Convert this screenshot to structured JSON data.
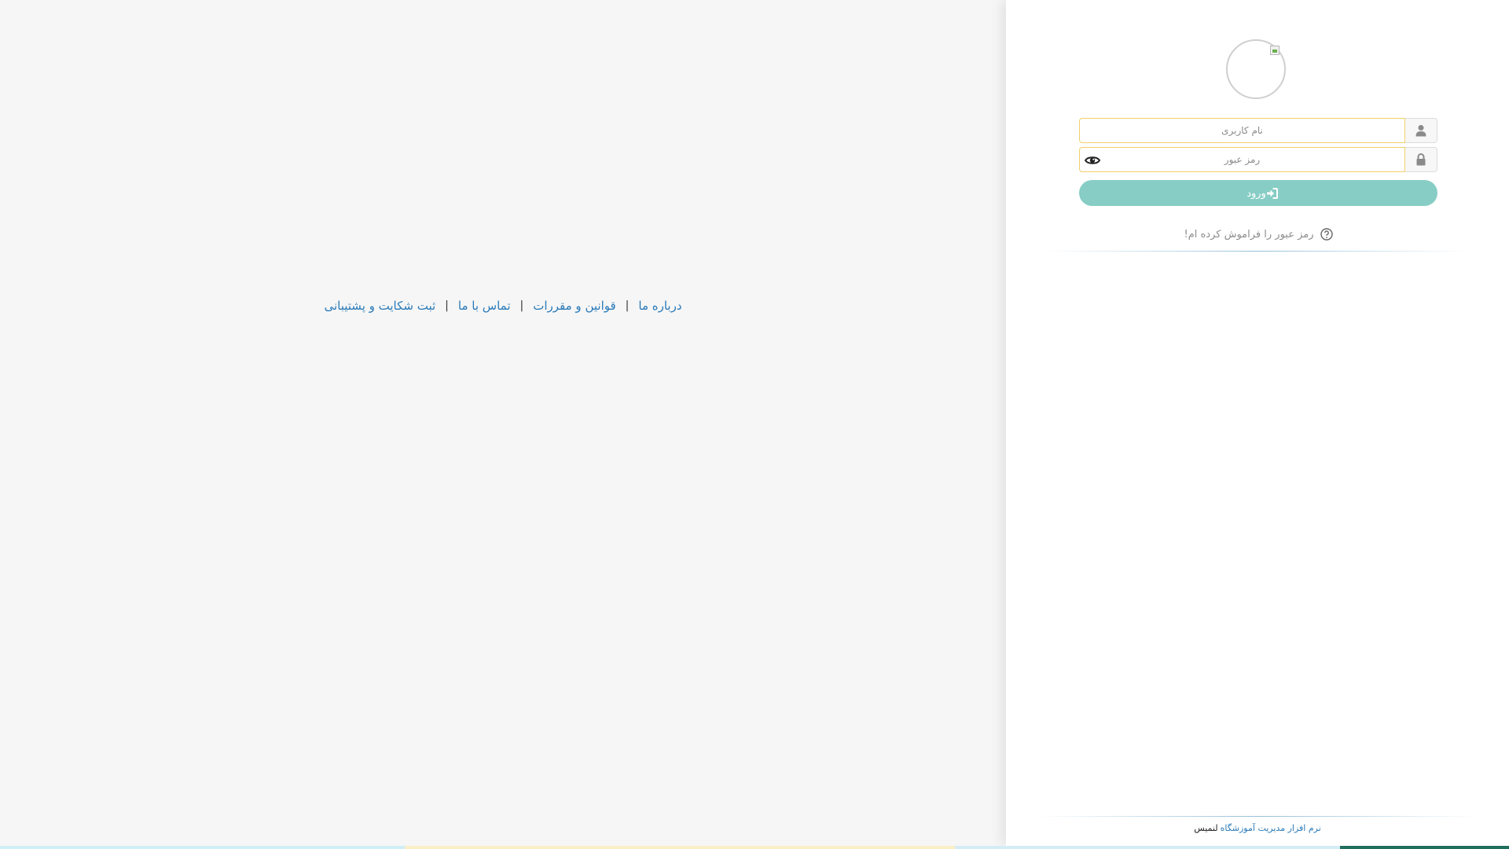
{
  "footer_links": [
    {
      "label": "درباره ما"
    },
    {
      "label": "قوانین و مقررات"
    },
    {
      "label": "تماس با ما"
    },
    {
      "label": "ثبت شکایت و پشتیبانی"
    }
  ],
  "separator": "|",
  "login": {
    "username_placeholder": "نام کاربری",
    "password_placeholder": "رمز عبور",
    "submit_label": "ورود",
    "forgot_label": "رمز عبور را فراموش کرده ام!"
  },
  "credit": {
    "product": "نرم افزار مدیریت آموزشگاه",
    "brand": "لنمیس"
  },
  "icons": {
    "username": "user-icon",
    "password": "lock-icon",
    "show_password": "eye-icon",
    "submit": "sign-in-icon",
    "forgot": "question-circle-icon"
  },
  "colors": {
    "accent": "#87cdc5",
    "link": "#2a7ab8",
    "field_border": "#f2cf6a"
  }
}
